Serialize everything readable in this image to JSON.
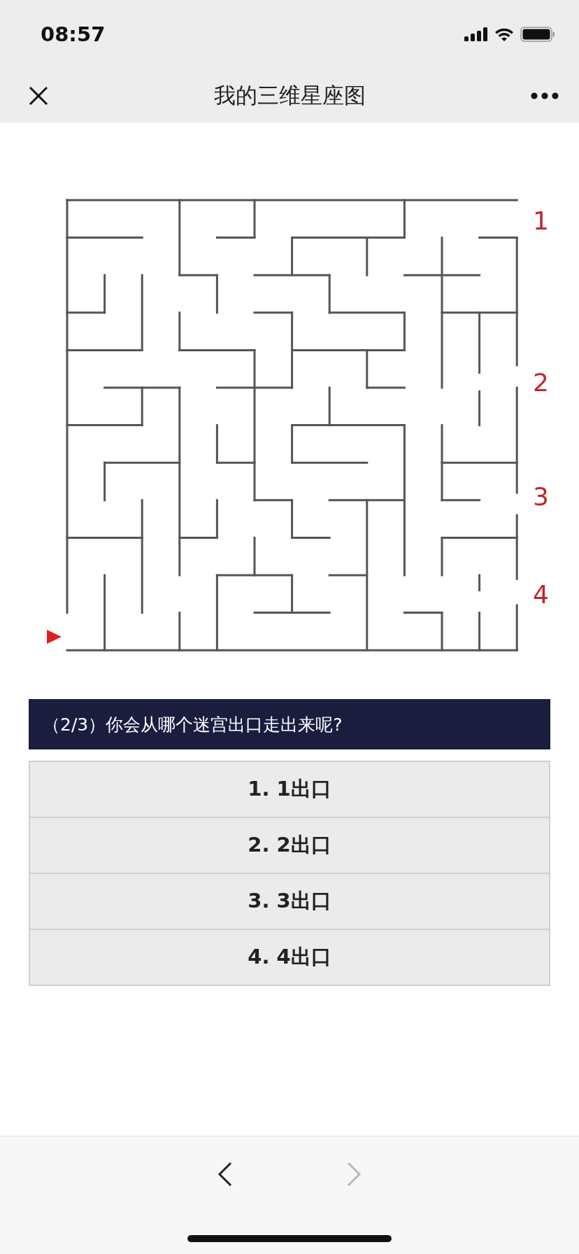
{
  "status_bar": {
    "time": "08:57"
  },
  "header": {
    "title": "我的三维星座图"
  },
  "maze": {
    "exit_labels": [
      "1",
      "2",
      "3",
      "4"
    ]
  },
  "question": {
    "text": "（2/3）你会从哪个迷宫出口走出来呢?"
  },
  "options": [
    {
      "label": "1. 1出口"
    },
    {
      "label": "2. 2出口"
    },
    {
      "label": "3. 3出口"
    },
    {
      "label": "4. 4出口"
    }
  ],
  "nav": {
    "back": {
      "disabled": false
    },
    "forward": {
      "disabled": true
    }
  }
}
